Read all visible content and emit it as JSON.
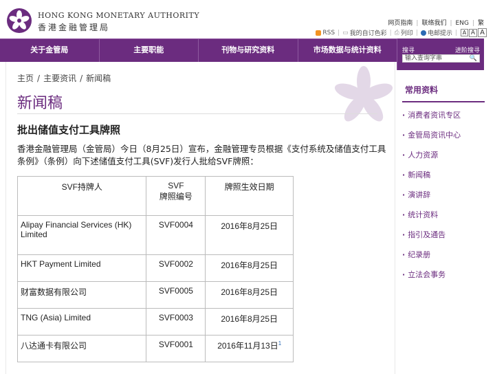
{
  "header": {
    "brand_en": "HONG KONG MONETARY AUTHORITY",
    "brand_zh": "香港金融管理局",
    "top_links": [
      "网页指南",
      "联络我们",
      "ENG",
      "繁"
    ],
    "util": {
      "rss": "RSS",
      "my_subs": "我的自订色彩",
      "print": "列印",
      "email_alert": "电邮提示",
      "font_sizes": [
        "A",
        "A",
        "A"
      ]
    }
  },
  "nav": {
    "items": [
      "关于金管局",
      "主要职能",
      "刊物与研究资料",
      "市场数据与统计资料"
    ]
  },
  "search": {
    "label": "搜寻",
    "advanced": "进阶搜寻",
    "placeholder": "输入查询字串"
  },
  "breadcrumb": [
    "主页",
    "主要资讯",
    "新闻稿"
  ],
  "page_title": "新闻稿",
  "article": {
    "title": "批出储值支付工具牌照",
    "intro": "香港金融管理局（金管局）今日（8月25日）宣布，金融管理专员根据《支付系统及储值支付工具条例》（条例）向下述储值支付工具(SVF)发行人批给SVF牌照："
  },
  "table": {
    "headers": [
      "SVF持牌人",
      "SVF\n牌照编号",
      "牌照生效日期"
    ],
    "rows": [
      {
        "holder": "Alipay Financial Services (HK) Limited",
        "license": "SVF0004",
        "date": "2016年8月25日",
        "note": ""
      },
      {
        "holder": "HKT Payment Limited",
        "license": "SVF0002",
        "date": "2016年8月25日",
        "note": ""
      },
      {
        "holder": "财富数据有限公司",
        "license": "SVF0005",
        "date": "2016年8月25日",
        "note": ""
      },
      {
        "holder": "TNG (Asia) Limited",
        "license": "SVF0003",
        "date": "2016年8月25日",
        "note": ""
      },
      {
        "holder": "八达通卡有限公司",
        "license": "SVF0001",
        "date": "2016年11月13日",
        "note": "1"
      }
    ]
  },
  "sidebar": {
    "title": "常用资料",
    "items": [
      "消费者资讯专区",
      "金管局资讯中心",
      "人力资源",
      "新闻稿",
      "演讲辞",
      "统计资料",
      "指引及通告",
      "纪录册",
      "立法会事务"
    ]
  },
  "colors": {
    "brand": "#6b2c7f",
    "link": "#2a6ab4"
  }
}
